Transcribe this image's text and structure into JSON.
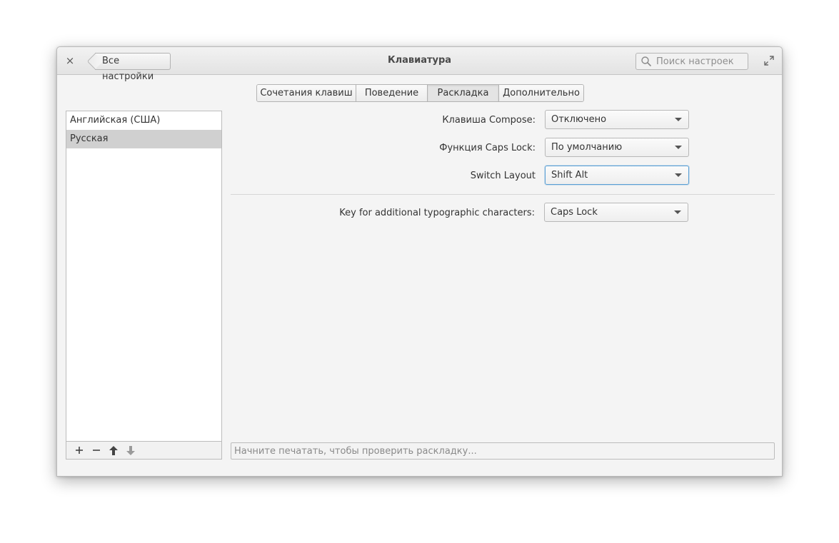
{
  "window": {
    "title": "Клавиатура",
    "back_label": "Все настройки",
    "close_glyph": "×",
    "search_placeholder": "Поиск настроек"
  },
  "tabs": [
    {
      "label": "Сочетания клавиш",
      "active": false
    },
    {
      "label": "Поведение",
      "active": false
    },
    {
      "label": "Раскладка",
      "active": true
    },
    {
      "label": "Дополнительно",
      "active": false
    }
  ],
  "layouts": {
    "items": [
      {
        "label": "Английская (США)",
        "selected": false
      },
      {
        "label": "Русская",
        "selected": true
      }
    ],
    "toolbar": {
      "add_glyph": "+",
      "remove_glyph": "−"
    }
  },
  "settings": {
    "compose": {
      "label": "Клавиша Compose:",
      "value": "Отключено"
    },
    "caps_lock": {
      "label": "Функция Caps Lock:",
      "value": "По умолчанию"
    },
    "switch_layout": {
      "label": "Switch Layout",
      "value": "Shift Alt"
    },
    "typographic": {
      "label": "Key for additional typographic characters:",
      "value": "Caps Lock"
    }
  },
  "test_entry": {
    "placeholder": "Начните печатать, чтобы проверить раскладку..."
  },
  "colors": {
    "window_bg": "#f4f4f4",
    "selected_row": "#d0d0d0",
    "focus_ring": "#5a9fd4"
  }
}
